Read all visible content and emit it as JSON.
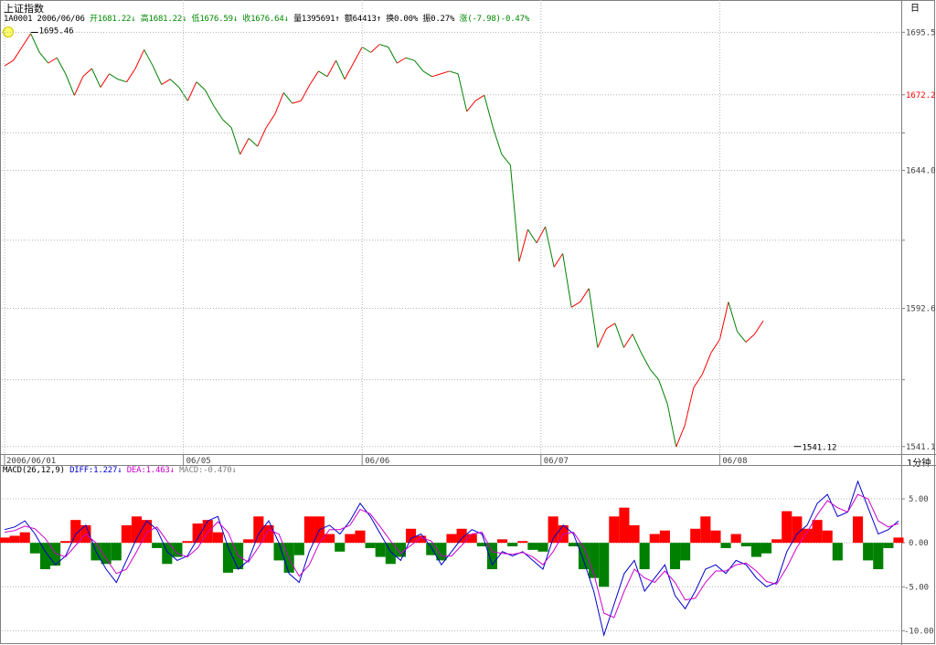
{
  "header": {
    "title": "上证指数",
    "code": "1A0001",
    "date": "2006/06/06",
    "open_label": "开",
    "open": "1681.22",
    "high_label": "高",
    "high": "1681.22",
    "low_label": "低",
    "low": "1676.59",
    "close_label": "收",
    "close": "1676.64",
    "volume_label": "量",
    "volume": "1395691",
    "amount_label": "额",
    "amount": "64413",
    "turnover_label": "换",
    "turnover": "0.00%",
    "amplitude_label": "振",
    "amplitude": "0.27%",
    "change_label": "涨",
    "change": "(-7.98)-0.47%",
    "period": "日",
    "interval": "1分钟"
  },
  "macd_header": {
    "label": "MACD(26,12,9)",
    "diff_label": "DIFF:",
    "diff": "1.227",
    "dea_label": "DEA:",
    "dea": "1.463",
    "macd_label": "MACD:",
    "macd": "-0.470"
  },
  "colors": {
    "up": "#ff0000",
    "down": "#008000",
    "diff_line": "#0000cc",
    "dea_line": "#cc00cc",
    "grid": "#b4b4b4",
    "highlight_label": "#ff0000"
  },
  "chart_data": [
    {
      "type": "line",
      "name": "price",
      "y_axis_ticks": [
        "1695.5",
        "1672.2",
        "1644.0",
        "1592.6",
        "1541.1"
      ],
      "y_axis_tick_values": [
        1695.5,
        1672.2,
        1644.0,
        1592.6,
        1541.1
      ],
      "highlighted_tick": "1672.2",
      "ylim": [
        1540,
        1698
      ],
      "x_tick_labels": [
        "2006/06/01",
        "06/05",
        "06/06",
        "06/07",
        "06/08"
      ],
      "x_tick_positions": [
        0,
        41,
        82,
        123,
        164
      ],
      "annotations": [
        {
          "text": "1695.46",
          "x": 6,
          "y": 1695.46
        },
        {
          "text": "1541.12",
          "x": 181,
          "y": 1541.12
        }
      ],
      "x": [
        0,
        2,
        4,
        6,
        8,
        10,
        12,
        14,
        16,
        18,
        20,
        22,
        24,
        26,
        28,
        30,
        32,
        34,
        36,
        38,
        40,
        42,
        44,
        46,
        48,
        50,
        52,
        54,
        56,
        58,
        60,
        62,
        64,
        66,
        68,
        70,
        72,
        74,
        76,
        78,
        80,
        82,
        84,
        86,
        88,
        90,
        92,
        94,
        96,
        98,
        100,
        102,
        104,
        106,
        108,
        110,
        112,
        114,
        116,
        118,
        120,
        122,
        124,
        126,
        128,
        130,
        132,
        134,
        136,
        138,
        140,
        142,
        144,
        146,
        148,
        150,
        152,
        154,
        156,
        158,
        160,
        162,
        164,
        166,
        168,
        170,
        172,
        174,
        176,
        178,
        180,
        182,
        184,
        186,
        188,
        190,
        192,
        194,
        196,
        198,
        200,
        202,
        204,
        206
      ],
      "y": [
        1683,
        1685,
        1690,
        1695,
        1688,
        1684,
        1686,
        1680,
        1672,
        1679,
        1682,
        1675,
        1680,
        1678,
        1677,
        1682,
        1689,
        1683,
        1676,
        1678,
        1675,
        1670,
        1677,
        1674,
        1668,
        1663,
        1660,
        1650,
        1656,
        1653,
        1660,
        1665,
        1673,
        1669,
        1670,
        1676,
        1681,
        1679,
        1685,
        1678,
        1684,
        1690,
        1688,
        1691,
        1690,
        1684,
        1686,
        1685,
        1681,
        1679,
        1680,
        1681,
        1680,
        1666,
        1670,
        1672,
        1660,
        1650,
        1646,
        1610,
        1622,
        1617,
        1623,
        1608,
        1613,
        1593,
        1595,
        1600,
        1578,
        1585,
        1587,
        1578,
        1583,
        1576,
        1570,
        1566,
        1557,
        1541,
        1549,
        1563,
        1568,
        1576,
        1581,
        1595,
        1584,
        1580,
        1583,
        1588
      ]
    },
    {
      "type": "bar",
      "name": "MACD",
      "y_axis_ticks": [
        "5.00",
        "0.00",
        "-5.00",
        "-10.00"
      ],
      "y_axis_tick_values": [
        5,
        0,
        -5,
        -10
      ],
      "ylim": [
        -11,
        7.5
      ],
      "series": [
        {
          "name": "DIFF",
          "values": [
            1.5,
            1.8,
            2.5,
            1.0,
            -1.0,
            -2.5,
            -1.5,
            1.0,
            2.0,
            -1.0,
            -3.0,
            -4.5,
            -2.0,
            0.5,
            2.5,
            1.5,
            -1.0,
            -2.0,
            -1.5,
            0.5,
            2.5,
            3.0,
            -0.5,
            -3.0,
            -2.0,
            1.0,
            2.5,
            0.0,
            -3.5,
            -4.5,
            -1.0,
            1.5,
            2.0,
            1.0,
            2.5,
            4.5,
            3.0,
            1.0,
            -1.0,
            -2.0,
            0.5,
            1.0,
            -0.5,
            -2.5,
            -1.0,
            0.5,
            1.5,
            1.0,
            -2.5,
            -1.0,
            -1.5,
            -1.0,
            -2.0,
            -3.0,
            0.5,
            2.0,
            1.0,
            -2.0,
            -5.5,
            -10.5,
            -7.0,
            -3.5,
            -2.0,
            -5.5,
            -4.0,
            -2.5,
            -6.0,
            -7.5,
            -5.5,
            -3.0,
            -2.5,
            -3.5,
            -2.0,
            -2.5,
            -4.0,
            -5.0,
            -4.5,
            -1.0,
            1.0,
            2.0,
            4.5,
            5.5,
            3.0,
            3.5,
            7.0,
            4.0,
            1.0,
            1.5,
            2.5
          ]
        },
        {
          "name": "DEA",
          "values": [
            1.2,
            1.4,
            1.9,
            1.6,
            0.5,
            -1.2,
            -1.6,
            -0.3,
            1.0,
            0.0,
            -1.8,
            -3.5,
            -3.0,
            -1.0,
            1.2,
            1.8,
            0.2,
            -1.2,
            -1.6,
            -0.6,
            1.2,
            2.4,
            1.2,
            -1.5,
            -2.2,
            -0.5,
            1.5,
            1.0,
            -1.8,
            -3.8,
            -2.5,
            0.0,
            1.5,
            1.5,
            2.0,
            3.8,
            3.3,
            1.8,
            0.2,
            -1.2,
            -0.3,
            0.6,
            0.2,
            -1.5,
            -1.5,
            -0.3,
            1.0,
            1.2,
            -1.0,
            -1.2,
            -1.3,
            -1.1,
            -1.6,
            -2.5,
            -1.0,
            1.0,
            1.2,
            -0.5,
            -3.5,
            -8.0,
            -8.5,
            -5.5,
            -3.0,
            -4.0,
            -4.5,
            -3.2,
            -4.5,
            -6.5,
            -6.3,
            -4.5,
            -3.2,
            -3.2,
            -2.5,
            -2.3,
            -3.2,
            -4.4,
            -4.7,
            -2.8,
            -0.5,
            1.2,
            3.2,
            4.8,
            4.0,
            3.5,
            5.5,
            5.0,
            2.5,
            1.8,
            2.2
          ]
        }
      ],
      "histogram": [
        0.6,
        0.8,
        1.2,
        -1.2,
        -3.0,
        -2.6,
        0.2,
        2.6,
        2.0,
        -2.0,
        -2.4,
        -2.0,
        2.0,
        3.0,
        2.6,
        -0.6,
        -2.4,
        -1.6,
        0.2,
        2.2,
        2.6,
        1.2,
        -3.4,
        -3.0,
        0.4,
        3.0,
        2.0,
        -2.0,
        -3.4,
        -1.4,
        3.0,
        3.0,
        1.0,
        -1.0,
        1.0,
        1.4,
        -0.6,
        -1.6,
        -2.4,
        -1.6,
        1.6,
        0.8,
        -1.4,
        -2.0,
        1.0,
        1.6,
        1.0,
        -0.4,
        -3.0,
        0.4,
        -0.4,
        0.2,
        -0.8,
        -1.0,
        3.0,
        2.0,
        -0.4,
        -3.0,
        -4.0,
        -5.0,
        3.0,
        4.0,
        2.0,
        -3.0,
        1.0,
        1.4,
        -3.0,
        -2.0,
        1.6,
        3.0,
        1.4,
        -0.6,
        1.0,
        -0.4,
        -1.6,
        -1.2,
        0.4,
        3.6,
        3.0,
        1.6,
        2.6,
        1.4,
        -2.0,
        0.0,
        3.0,
        -2.0,
        -3.0,
        -0.6,
        0.6
      ]
    }
  ]
}
